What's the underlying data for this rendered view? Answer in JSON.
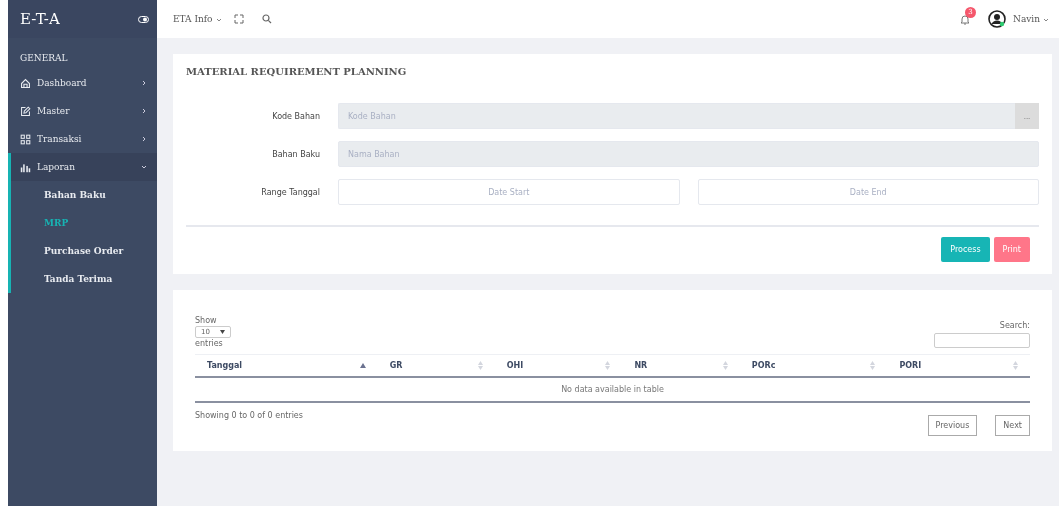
{
  "sidebar": {
    "brand": "E-T-A",
    "section": "GENERAL",
    "items": [
      {
        "label": "Dashboard",
        "expanded": false
      },
      {
        "label": "Master",
        "expanded": false
      },
      {
        "label": "Transaksi",
        "expanded": false
      },
      {
        "label": "Laporan",
        "expanded": true,
        "children": [
          {
            "label": "Bahan Baku",
            "selected": false
          },
          {
            "label": "MRP",
            "selected": true
          },
          {
            "label": "Purchase Order",
            "selected": false
          },
          {
            "label": "Tanda Terima",
            "selected": false
          }
        ]
      }
    ]
  },
  "topbar": {
    "menu": "ETA Info",
    "notification_count": "3",
    "user": "Navin"
  },
  "form_card": {
    "title": "MATERIAL REQUIREMENT PLANNING",
    "fields": [
      {
        "label": "Kode Bahan",
        "kind": "lookup",
        "placeholder": "Kode Bahan",
        "button": "..."
      },
      {
        "label": "Bahan Baku",
        "kind": "readonly",
        "placeholder": "Nama Bahan"
      },
      {
        "label": "Range Tanggal",
        "kind": "range",
        "placeholders": [
          "Date Start",
          "Date End"
        ]
      }
    ],
    "buttons": [
      {
        "label": "Process",
        "kind": "primary"
      },
      {
        "label": "Print",
        "kind": "danger"
      }
    ]
  },
  "table_card": {
    "length_label": "Show",
    "length_value": "10",
    "length_suffix": "entries",
    "search_label": "Search:",
    "columns": [
      {
        "label": "Tanggal",
        "sorted": true
      },
      {
        "label": "GR",
        "sorted": false
      },
      {
        "label": "OHI",
        "sorted": false
      },
      {
        "label": "NR",
        "sorted": false
      },
      {
        "label": "PORc",
        "sorted": false
      },
      {
        "label": "PORI",
        "sorted": false
      }
    ],
    "empty_message": "No data available in table",
    "info": "Showing 0 to 0 of 0 entries",
    "pagination": [
      "Previous",
      "Next"
    ]
  }
}
